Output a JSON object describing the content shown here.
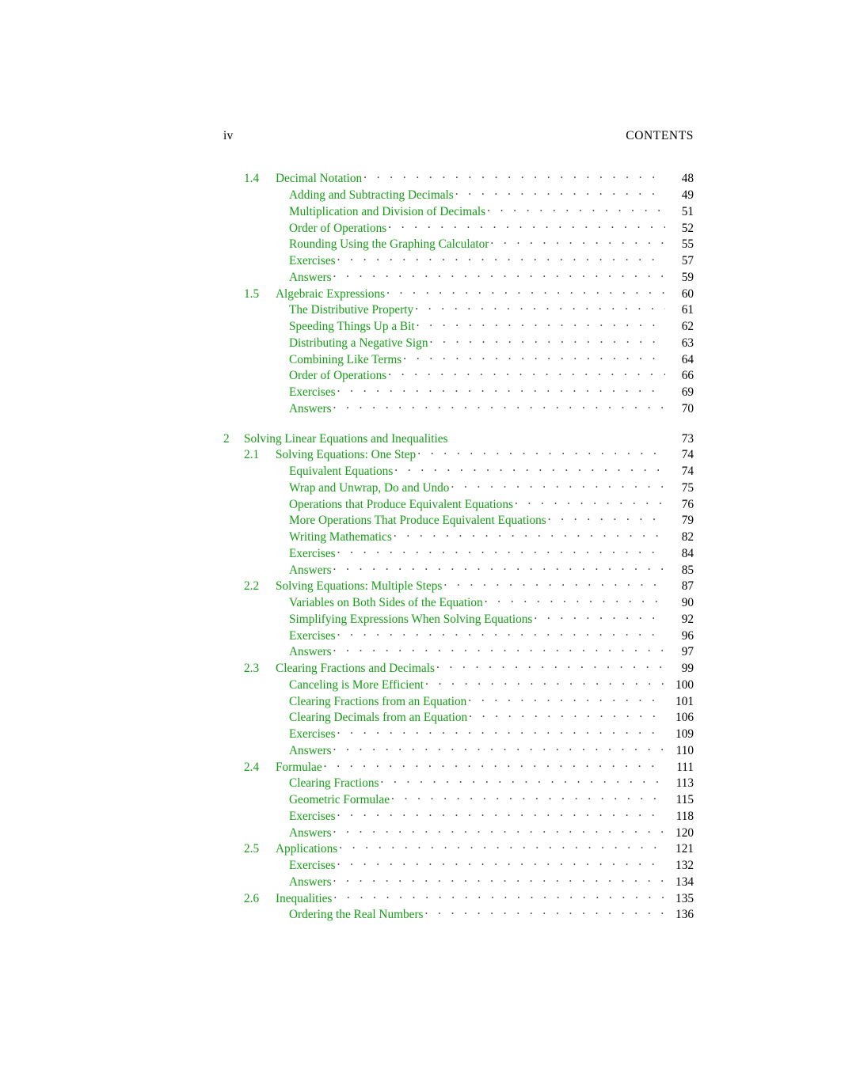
{
  "header": {
    "folio": "iv",
    "running_title": "CONTENTS"
  },
  "colors": {
    "entry_green": "#179c17",
    "page_number_black": "#000000",
    "leader_dots": "#3a3a3a"
  },
  "toc": {
    "entries": [
      {
        "level": 1,
        "number": "1.4",
        "title": "Decimal Notation",
        "page": "48",
        "leaders": true
      },
      {
        "level": 2,
        "number": "",
        "title": "Adding and Subtracting Decimals",
        "page": "49",
        "leaders": true
      },
      {
        "level": 2,
        "number": "",
        "title": "Multiplication and Division of Decimals",
        "page": "51",
        "leaders": true
      },
      {
        "level": 2,
        "number": "",
        "title": "Order of Operations",
        "page": "52",
        "leaders": true
      },
      {
        "level": 2,
        "number": "",
        "title": "Rounding Using the Graphing Calculator",
        "page": "55",
        "leaders": true
      },
      {
        "level": 2,
        "number": "",
        "title": "Exercises",
        "page": "57",
        "leaders": true
      },
      {
        "level": 2,
        "number": "",
        "title": "Answers",
        "page": "59",
        "leaders": true
      },
      {
        "level": 1,
        "number": "1.5",
        "title": "Algebraic Expressions",
        "page": "60",
        "leaders": true
      },
      {
        "level": 2,
        "number": "",
        "title": "The Distributive Property",
        "page": "61",
        "leaders": true
      },
      {
        "level": 2,
        "number": "",
        "title": "Speeding Things Up a Bit",
        "page": "62",
        "leaders": true
      },
      {
        "level": 2,
        "number": "",
        "title": "Distributing a Negative Sign",
        "page": "63",
        "leaders": true
      },
      {
        "level": 2,
        "number": "",
        "title": "Combining Like Terms",
        "page": "64",
        "leaders": true
      },
      {
        "level": 2,
        "number": "",
        "title": "Order of Operations",
        "page": "66",
        "leaders": true
      },
      {
        "level": 2,
        "number": "",
        "title": "Exercises",
        "page": "69",
        "leaders": true
      },
      {
        "level": 2,
        "number": "",
        "title": "Answers",
        "page": "70",
        "leaders": true
      },
      {
        "level": 0,
        "number": "2",
        "title": "Solving Linear Equations and Inequalities",
        "page": "73",
        "leaders": false,
        "gap_before": true
      },
      {
        "level": 1,
        "number": "2.1",
        "title": "Solving Equations: One Step",
        "page": "74",
        "leaders": true
      },
      {
        "level": 2,
        "number": "",
        "title": "Equivalent Equations",
        "page": "74",
        "leaders": true
      },
      {
        "level": 2,
        "number": "",
        "title": "Wrap and Unwrap, Do and Undo",
        "page": "75",
        "leaders": true
      },
      {
        "level": 2,
        "number": "",
        "title": "Operations that Produce Equivalent Equations",
        "page": "76",
        "leaders": true
      },
      {
        "level": 2,
        "number": "",
        "title": "More Operations That Produce Equivalent Equations",
        "page": "79",
        "leaders": true
      },
      {
        "level": 2,
        "number": "",
        "title": "Writing Mathematics",
        "page": "82",
        "leaders": true
      },
      {
        "level": 2,
        "number": "",
        "title": "Exercises",
        "page": "84",
        "leaders": true
      },
      {
        "level": 2,
        "number": "",
        "title": "Answers",
        "page": "85",
        "leaders": true
      },
      {
        "level": 1,
        "number": "2.2",
        "title": "Solving Equations: Multiple Steps",
        "page": "87",
        "leaders": true
      },
      {
        "level": 2,
        "number": "",
        "title": "Variables on Both Sides of the Equation",
        "page": "90",
        "leaders": true
      },
      {
        "level": 2,
        "number": "",
        "title": "Simplifying Expressions When Solving Equations",
        "page": "92",
        "leaders": true
      },
      {
        "level": 2,
        "number": "",
        "title": "Exercises",
        "page": "96",
        "leaders": true
      },
      {
        "level": 2,
        "number": "",
        "title": "Answers",
        "page": "97",
        "leaders": true
      },
      {
        "level": 1,
        "number": "2.3",
        "title": "Clearing Fractions and Decimals",
        "page": "99",
        "leaders": true
      },
      {
        "level": 2,
        "number": "",
        "title": "Canceling is More Efficient",
        "page": "100",
        "leaders": true
      },
      {
        "level": 2,
        "number": "",
        "title": "Clearing Fractions from an Equation",
        "page": "101",
        "leaders": true
      },
      {
        "level": 2,
        "number": "",
        "title": "Clearing Decimals from an Equation",
        "page": "106",
        "leaders": true
      },
      {
        "level": 2,
        "number": "",
        "title": "Exercises",
        "page": "109",
        "leaders": true
      },
      {
        "level": 2,
        "number": "",
        "title": "Answers",
        "page": "110",
        "leaders": true
      },
      {
        "level": 1,
        "number": "2.4",
        "title": "Formulae",
        "page": "111",
        "leaders": true
      },
      {
        "level": 2,
        "number": "",
        "title": "Clearing Fractions",
        "page": "113",
        "leaders": true
      },
      {
        "level": 2,
        "number": "",
        "title": "Geometric Formulae",
        "page": "115",
        "leaders": true
      },
      {
        "level": 2,
        "number": "",
        "title": "Exercises",
        "page": "118",
        "leaders": true
      },
      {
        "level": 2,
        "number": "",
        "title": "Answers",
        "page": "120",
        "leaders": true
      },
      {
        "level": 1,
        "number": "2.5",
        "title": "Applications",
        "page": "121",
        "leaders": true
      },
      {
        "level": 2,
        "number": "",
        "title": "Exercises",
        "page": "132",
        "leaders": true
      },
      {
        "level": 2,
        "number": "",
        "title": "Answers",
        "page": "134",
        "leaders": true
      },
      {
        "level": 1,
        "number": "2.6",
        "title": "Inequalities",
        "page": "135",
        "leaders": true
      },
      {
        "level": 2,
        "number": "",
        "title": "Ordering the Real Numbers",
        "page": "136",
        "leaders": true
      }
    ]
  }
}
